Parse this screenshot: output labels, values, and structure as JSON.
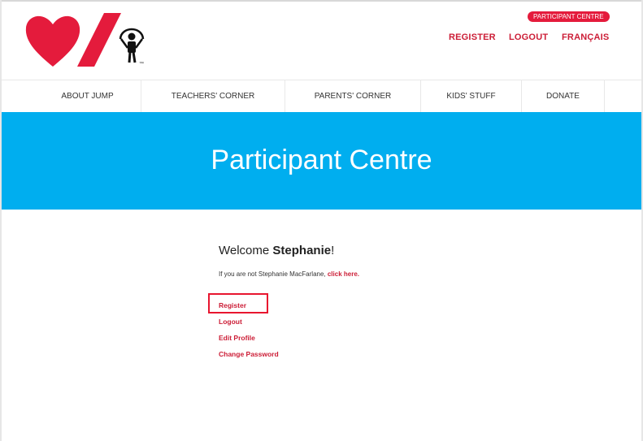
{
  "header": {
    "badge": "PARTICIPANT CENTRE",
    "links": [
      "REGISTER",
      "LOGOUT",
      "FRANÇAIS"
    ],
    "logo_mark": "™",
    "colors": {
      "brand_red": "#e41b3c",
      "link_red": "#cc1d36"
    }
  },
  "nav": {
    "items": [
      "ABOUT JUMP",
      "TEACHERS' CORNER",
      "PARENTS' CORNER",
      "KIDS' STUFF",
      "DONATE"
    ]
  },
  "banner": {
    "title": "Participant Centre",
    "color": "#00aeef"
  },
  "main": {
    "welcome_prefix": "Welcome ",
    "user_name": "Stephanie",
    "welcome_suffix": "!",
    "notice_text": "If you are not Stephanie MacFarlane, ",
    "notice_link": "click here.",
    "links": [
      "Register",
      "Logout",
      "Edit Profile",
      "Change Password"
    ]
  }
}
